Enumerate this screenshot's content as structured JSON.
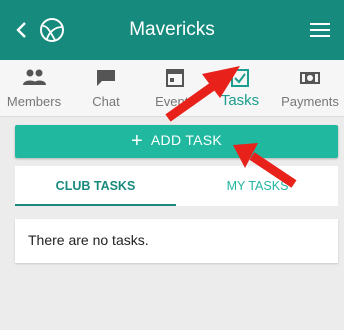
{
  "header": {
    "title": "Mavericks",
    "back_icon": "chevron-left-icon",
    "logo_icon": "club-logo-icon",
    "menu_icon": "hamburger-menu-icon"
  },
  "tabs": [
    {
      "label": "Members",
      "icon": "members-icon"
    },
    {
      "label": "Chat",
      "icon": "chat-icon"
    },
    {
      "label": "Events",
      "icon": "calendar-icon"
    },
    {
      "label": "Tasks",
      "icon": "checkbox-icon",
      "active": true
    },
    {
      "label": "Payments",
      "icon": "payments-icon"
    }
  ],
  "add_task": {
    "label": "ADD TASK",
    "icon": "plus-icon"
  },
  "subtabs": {
    "club": "CLUB TASKS",
    "my": "MY TASKS"
  },
  "empty_message": "There are no tasks.",
  "colors": {
    "primary": "#168a7c",
    "button": "#20b99f",
    "accent": "#1a9e8e",
    "arrow": "#e8211b"
  }
}
